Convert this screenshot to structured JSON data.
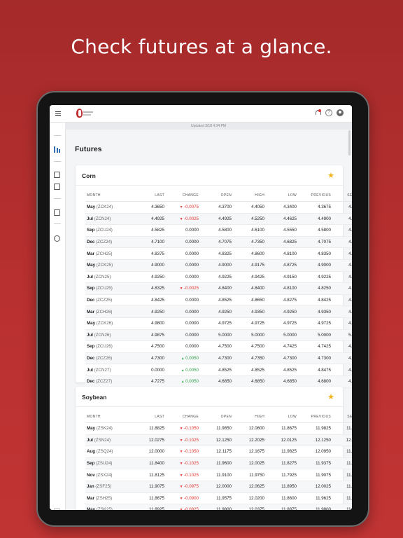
{
  "headline": "Check futures at a glance.",
  "topbar": {
    "icons": [
      "menu-icon",
      "bell-icon",
      "help-icon",
      "user-icon"
    ]
  },
  "updated": "Updated 3/18 4:34 PM",
  "page_title": "Futures",
  "columns": [
    "MONTH",
    "LAST",
    "CHANGE",
    "OPEN",
    "HIGH",
    "LOW",
    "PREVIOUS",
    "SETTLE"
  ],
  "colors": {
    "negative": "#e0342f",
    "positive": "#2e9f48",
    "star": "#f2b31a",
    "brand": "#b93030"
  },
  "cards": [
    {
      "title": "Corn",
      "rows": [
        {
          "m": "May",
          "s": "(ZCK24)",
          "last": "4.3650",
          "dir": "down",
          "chg": "-0.0075",
          "open": "4.3700",
          "high": "4.4050",
          "low": "4.3400",
          "prev": "4.3675",
          "settle": "4.3600"
        },
        {
          "m": "Jul",
          "s": "(ZCN24)",
          "last": "4.4925",
          "dir": "down",
          "chg": "-0.0025",
          "open": "4.4925",
          "high": "4.5250",
          "low": "4.4625",
          "prev": "4.4900",
          "settle": "4.4875"
        },
        {
          "m": "Sep",
          "s": "(ZCU24)",
          "last": "4.5825",
          "dir": "",
          "chg": "0.0000",
          "open": "4.5800",
          "high": "4.6100",
          "low": "4.5550",
          "prev": "4.5800",
          "settle": "4.5800"
        },
        {
          "m": "Dec",
          "s": "(ZCZ24)",
          "last": "4.7100",
          "dir": "",
          "chg": "0.0000",
          "open": "4.7075",
          "high": "4.7350",
          "low": "4.6825",
          "prev": "4.7075",
          "settle": "4.7075"
        },
        {
          "m": "Mar",
          "s": "(ZCH25)",
          "last": "4.8375",
          "dir": "",
          "chg": "0.0000",
          "open": "4.8325",
          "high": "4.8600",
          "low": "4.8100",
          "prev": "4.8350",
          "settle": "4.8350"
        },
        {
          "m": "May",
          "s": "(ZCK25)",
          "last": "4.9000",
          "dir": "",
          "chg": "0.0000",
          "open": "4.9000",
          "high": "4.9175",
          "low": "4.8725",
          "prev": "4.9000",
          "settle": "4.9000"
        },
        {
          "m": "Jul",
          "s": "(ZCN25)",
          "last": "4.9250",
          "dir": "",
          "chg": "0.0000",
          "open": "4.9225",
          "high": "4.9425",
          "low": "4.9150",
          "prev": "4.9225",
          "settle": "4.9225"
        },
        {
          "m": "Sep",
          "s": "(ZCU25)",
          "last": "4.8325",
          "dir": "down",
          "chg": "-0.0025",
          "open": "4.8400",
          "high": "4.8400",
          "low": "4.8100",
          "prev": "4.8250",
          "settle": "4.8225"
        },
        {
          "m": "Dec",
          "s": "(ZCZ25)",
          "last": "4.8425",
          "dir": "",
          "chg": "0.0000",
          "open": "4.8525",
          "high": "4.8650",
          "low": "4.8275",
          "prev": "4.8425",
          "settle": "4.8425"
        },
        {
          "m": "Mar",
          "s": "(ZCH26)",
          "last": "4.9250",
          "dir": "",
          "chg": "0.0000",
          "open": "4.9250",
          "high": "4.9350",
          "low": "4.9250",
          "prev": "4.9350",
          "settle": "4.9350"
        },
        {
          "m": "May",
          "s": "(ZCK26)",
          "last": "4.9800",
          "dir": "",
          "chg": "0.0000",
          "open": "4.9725",
          "high": "4.9725",
          "low": "4.9725",
          "prev": "4.9725",
          "settle": "4.9725"
        },
        {
          "m": "Jul",
          "s": "(ZCN26)",
          "last": "4.9875",
          "dir": "",
          "chg": "0.0000",
          "open": "5.0000",
          "high": "5.0000",
          "low": "5.0000",
          "prev": "5.0000",
          "settle": "5.0000"
        },
        {
          "m": "Sep",
          "s": "(ZCU26)",
          "last": "4.7500",
          "dir": "",
          "chg": "0.0000",
          "open": "4.7500",
          "high": "4.7500",
          "low": "4.7425",
          "prev": "4.7425",
          "settle": "4.7425"
        },
        {
          "m": "Dec",
          "s": "(ZCZ26)",
          "last": "4.7300",
          "dir": "up",
          "chg": "0.0050",
          "open": "4.7300",
          "high": "4.7350",
          "low": "4.7300",
          "prev": "4.7300",
          "settle": "4.7350"
        },
        {
          "m": "Jul",
          "s": "(ZCN27)",
          "last": "0.0000",
          "dir": "up",
          "chg": "0.0050",
          "open": "4.8525",
          "high": "4.8525",
          "low": "4.8525",
          "prev": "4.8475",
          "settle": "4.8525"
        },
        {
          "m": "Dec",
          "s": "(ZCZ27)",
          "last": "4.7275",
          "dir": "up",
          "chg": "0.0050",
          "open": "4.6850",
          "high": "4.6850",
          "low": "4.6850",
          "prev": "4.6800",
          "settle": "4.6850"
        }
      ]
    },
    {
      "title": "Soybean",
      "rows": [
        {
          "m": "May",
          "s": "(ZSK24)",
          "last": "11.8825",
          "dir": "down",
          "chg": "-0.1050",
          "open": "11.9850",
          "high": "12.0600",
          "low": "11.8675",
          "prev": "11.9825",
          "settle": "11.8775"
        },
        {
          "m": "Jul",
          "s": "(ZSN24)",
          "last": "12.0275",
          "dir": "down",
          "chg": "-0.1025",
          "open": "12.1250",
          "high": "12.2025",
          "low": "12.0125",
          "prev": "12.1250",
          "settle": "12.0225"
        },
        {
          "m": "Aug",
          "s": "(ZSQ24)",
          "last": "12.0000",
          "dir": "down",
          "chg": "-0.1050",
          "open": "12.1175",
          "high": "12.1675",
          "low": "11.9825",
          "prev": "12.0950",
          "settle": "11.9900"
        },
        {
          "m": "Sep",
          "s": "(ZSU24)",
          "last": "11.8400",
          "dir": "down",
          "chg": "-0.1025",
          "open": "11.9600",
          "high": "12.0025",
          "low": "11.8275",
          "prev": "11.9375",
          "settle": "11.8350"
        },
        {
          "m": "Nov",
          "s": "(ZSX24)",
          "last": "11.8125",
          "dir": "down",
          "chg": "-0.1025",
          "open": "11.9100",
          "high": "11.9750",
          "low": "11.7925",
          "prev": "11.9075",
          "settle": "11.8050"
        },
        {
          "m": "Jan",
          "s": "(ZSF25)",
          "last": "11.9075",
          "dir": "down",
          "chg": "-0.0975",
          "open": "12.0000",
          "high": "12.0625",
          "low": "11.8950",
          "prev": "12.0025",
          "settle": "11.9050"
        },
        {
          "m": "Mar",
          "s": "(ZSH25)",
          "last": "11.8675",
          "dir": "down",
          "chg": "-0.0900",
          "open": "11.9575",
          "high": "12.0200",
          "low": "11.8600",
          "prev": "11.9625",
          "settle": "11.8725"
        },
        {
          "m": "May",
          "s": "(ZSK25)",
          "last": "11.8925",
          "dir": "down",
          "chg": "-0.0825",
          "open": "11.9800",
          "high": "12.0375",
          "low": "11.8875",
          "prev": "11.9800",
          "settle": "11.8975"
        }
      ]
    }
  ]
}
